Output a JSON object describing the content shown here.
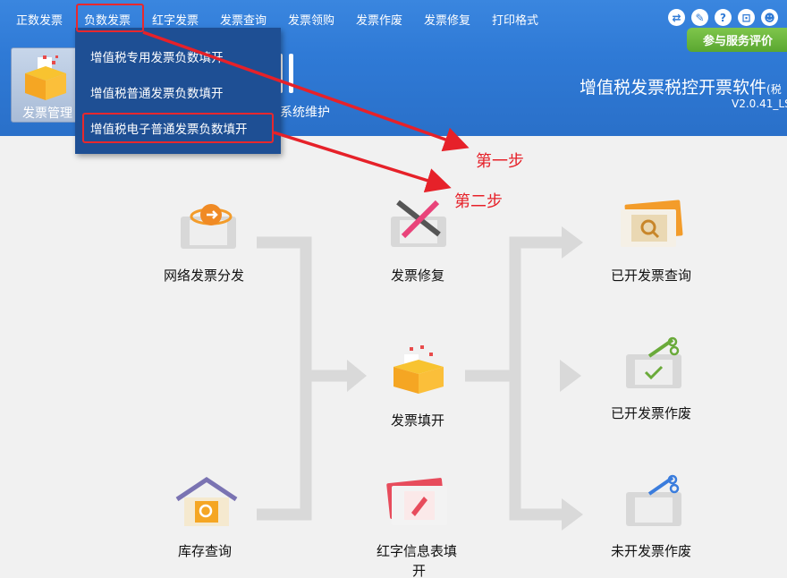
{
  "menu": {
    "items": [
      "正数发票",
      "负数发票",
      "红字发票",
      "发票查询",
      "发票领购",
      "发票作废",
      "发票修复",
      "打印格式"
    ]
  },
  "dropdown": {
    "items": [
      "增值税专用发票负数填开",
      "增值税普通发票负数填开",
      "增值税电子普通发票负数填开"
    ]
  },
  "toolbar": {
    "invoice_mgmt": "发票管理",
    "maintenance": "系统维护"
  },
  "header": {
    "feedback": "参与服务评价",
    "title": "增值税发票税控开票软件",
    "title_suffix": "(税",
    "version": "V2.0.41_LS"
  },
  "annotations": {
    "step1": "第一步",
    "step2": "第二步"
  },
  "tiles": {
    "network_distribute": "网络发票分发",
    "stock_query": "库存查询",
    "invoice_repair": "发票修复",
    "invoice_issue": "发票填开",
    "red_info_line1": "红字信息表填",
    "red_info_line2": "开",
    "issued_query": "已开发票查询",
    "issued_void": "已开发票作废",
    "unissued_void": "未开发票作废"
  },
  "colors": {
    "top_blue": "#2f7ad6",
    "dropdown_bg": "#1e4f94",
    "highlight_red": "#e8282d",
    "feedback_green": "#5aa730",
    "flow_gray": "#d9d9d9"
  }
}
